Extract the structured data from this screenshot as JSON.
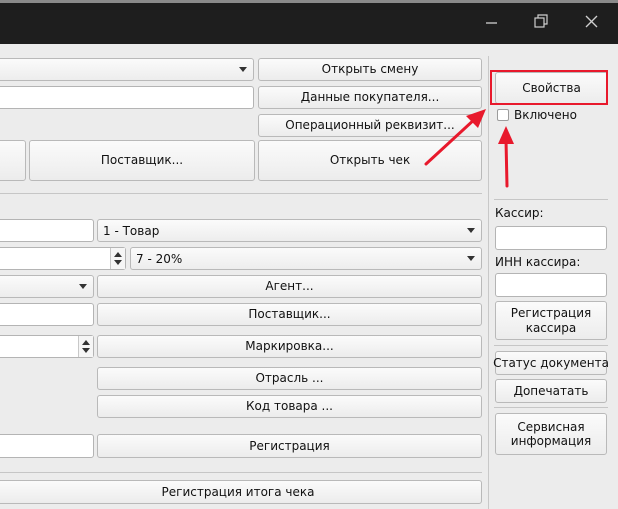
{
  "window": {
    "controls": [
      "minimize-icon",
      "restore-icon",
      "close-icon"
    ]
  },
  "left": {
    "open_shift": "Открыть смену",
    "buyer_data": "Данные покупателя...",
    "operational_requisite": "Операционный реквизит...",
    "supplier_top": "Поставщик...",
    "open_check": "Открыть чек",
    "item_type": "1 - Товар",
    "vat_rate": "7 - 20%",
    "agent": "Агент...",
    "supplier": "Поставщик...",
    "marking": "Маркировка...",
    "industry": "Отрасль ...",
    "product_code": "Код товара ...",
    "registration": "Регистрация",
    "register_total": "Регистрация итога чека"
  },
  "right": {
    "properties": "Свойства",
    "enabled_label": "Включено",
    "enabled_checked": false,
    "cashier_label": "Кассир:",
    "cashier_value": "",
    "cashier_inn_label": "ИНН кассира:",
    "cashier_inn_value": "",
    "register_cashier": "Регистрация кассира",
    "doc_status": "Статус документа",
    "reprint": "Допечатать",
    "service_info": "Сервисная информация"
  },
  "colors": {
    "annotation": "#e8192c",
    "titlebar": "#1e1e1e",
    "panel": "#ececec"
  }
}
